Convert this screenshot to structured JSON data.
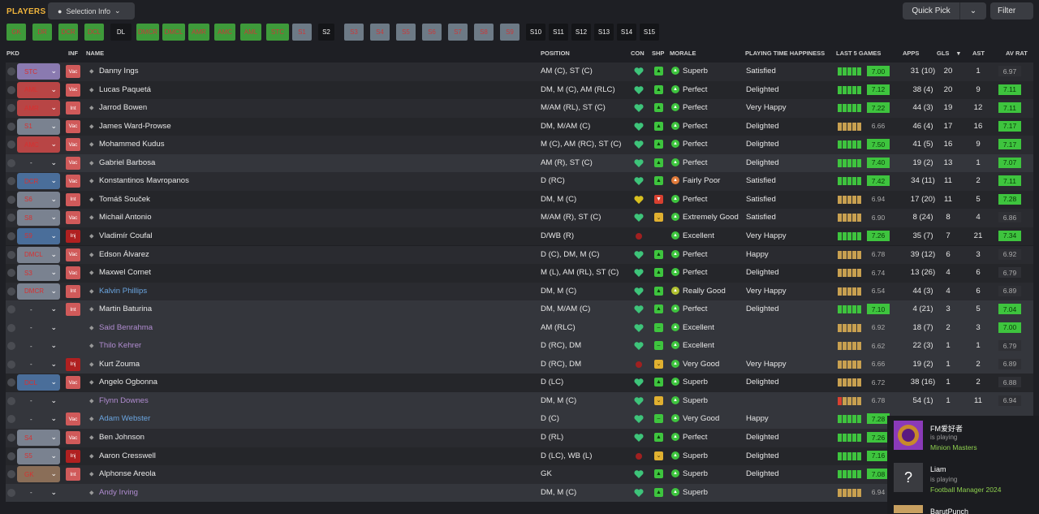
{
  "header": {
    "title": "PLAYERS",
    "selection_label": "Selection Info",
    "quick_pick_label": "Quick Pick",
    "filter_label": "Filter"
  },
  "position_tabs": [
    "GK",
    "DR",
    "DCR",
    "DCL",
    "DL",
    "DMCR",
    "DMCL",
    "AMR",
    "AMC",
    "AML",
    "STC",
    "S1",
    "S2",
    "S3",
    "S4",
    "S5",
    "S6",
    "S7",
    "S8",
    "S9",
    "S10",
    "S11",
    "S12",
    "S13",
    "S14",
    "S15"
  ],
  "columns": {
    "pkd": "PKD",
    "inf": "INF",
    "name": "NAME",
    "position": "POSITION",
    "con": "CON",
    "shp": "SHP",
    "morale": "MORALE",
    "pth": "PLAYING TIME HAPPINESS",
    "last5": "LAST 5 GAMES",
    "apps": "APPS",
    "gls": "GLS",
    "ast": "AST",
    "avrat": "AV RAT"
  },
  "players": [
    {
      "pkd": "STC",
      "pkdc": "purple",
      "inf": "Vac",
      "name": "Danny Ings",
      "nc": "white",
      "pos": "AM (C), ST (C)",
      "con": "green",
      "shp": "up",
      "mor": "Superb",
      "mc": "g",
      "pth": "Satisfied",
      "form": [
        "g",
        "g",
        "g",
        "g",
        "g"
      ],
      "rat": "7.00",
      "rh": true,
      "apps": "31 (10)",
      "gls": "20",
      "ast": "1",
      "av": "6.97",
      "ah": false
    },
    {
      "pkd": "AML",
      "pkdc": "red",
      "inf": "Vac",
      "name": "Lucas Paquetá",
      "nc": "white",
      "pos": "DM, M (C), AM (RLC)",
      "con": "green",
      "shp": "up",
      "mor": "Perfect",
      "mc": "g",
      "pth": "Delighted",
      "form": [
        "g",
        "g",
        "g",
        "g",
        "g"
      ],
      "rat": "7.12",
      "rh": true,
      "apps": "38 (4)",
      "gls": "20",
      "ast": "9",
      "av": "7.11",
      "ah": true
    },
    {
      "pkd": "AMR",
      "pkdc": "red",
      "inf": "Int",
      "name": "Jarrod Bowen",
      "nc": "white",
      "pos": "M/AM (RL), ST (C)",
      "con": "green",
      "shp": "up",
      "mor": "Perfect",
      "mc": "g",
      "pth": "Very Happy",
      "form": [
        "g",
        "g",
        "g",
        "g",
        "g"
      ],
      "rat": "7.22",
      "rh": true,
      "apps": "44 (3)",
      "gls": "19",
      "ast": "12",
      "av": "7.11",
      "ah": true
    },
    {
      "pkd": "S1",
      "pkdc": "slate",
      "inf": "Vac",
      "name": "James Ward-Prowse",
      "nc": "white",
      "pos": "DM, M/AM (C)",
      "con": "green",
      "shp": "up",
      "mor": "Perfect",
      "mc": "g",
      "pth": "Delighted",
      "form": [
        "y",
        "y",
        "y",
        "y",
        "y"
      ],
      "rat": "6.66",
      "rh": false,
      "apps": "46 (4)",
      "gls": "17",
      "ast": "16",
      "av": "7.17",
      "ah": true
    },
    {
      "pkd": "AMC",
      "pkdc": "red",
      "inf": "Vac",
      "name": "Mohammed Kudus",
      "nc": "white",
      "pos": "M (C), AM (RC), ST (C)",
      "con": "green",
      "shp": "up",
      "mor": "Perfect",
      "mc": "g",
      "pth": "Delighted",
      "form": [
        "g",
        "g",
        "g",
        "g",
        "g"
      ],
      "rat": "7.50",
      "rh": true,
      "apps": "41 (5)",
      "gls": "16",
      "ast": "9",
      "av": "7.17",
      "ah": true
    },
    {
      "pkd": "-",
      "pkdc": "none",
      "inf": "Vac",
      "name": "Gabriel Barbosa",
      "nc": "white",
      "pos": "AM (R), ST (C)",
      "con": "green",
      "shp": "up",
      "mor": "Perfect",
      "mc": "g",
      "pth": "Delighted",
      "form": [
        "g",
        "g",
        "g",
        "g",
        "g"
      ],
      "rat": "7.40",
      "rh": true,
      "apps": "19 (2)",
      "gls": "13",
      "ast": "1",
      "av": "7.07",
      "ah": true
    },
    {
      "pkd": "DCR",
      "pkdc": "blue",
      "inf": "Vac",
      "name": "Konstantinos Mavropanos",
      "nc": "white",
      "pos": "D (RC)",
      "con": "green",
      "shp": "up",
      "mor": "Fairly Poor",
      "mc": "o",
      "pth": "Satisfied",
      "form": [
        "g",
        "g",
        "g",
        "g",
        "g"
      ],
      "rat": "7.42",
      "rh": true,
      "apps": "34 (11)",
      "gls": "11",
      "ast": "2",
      "av": "7.11",
      "ah": true
    },
    {
      "pkd": "S6",
      "pkdc": "slate",
      "inf": "Int",
      "name": "Tomáš Souček",
      "nc": "white",
      "pos": "DM, M (C)",
      "con": "yellow",
      "shp": "down",
      "mor": "Perfect",
      "mc": "g",
      "pth": "Satisfied",
      "form": [
        "y",
        "y",
        "y",
        "y",
        "y"
      ],
      "rat": "6.94",
      "rh": false,
      "apps": "17 (20)",
      "gls": "11",
      "ast": "5",
      "av": "7.28",
      "ah": true
    },
    {
      "pkd": "S8",
      "pkdc": "slate",
      "inf": "Vac",
      "name": "Michail Antonio",
      "nc": "white",
      "pos": "M/AM (R), ST (C)",
      "con": "green",
      "shp": "down2",
      "mor": "Extremely Good",
      "mc": "g",
      "pth": "Satisfied",
      "form": [
        "y",
        "y",
        "y",
        "y",
        "y"
      ],
      "rat": "6.90",
      "rh": false,
      "apps": "8 (24)",
      "gls": "8",
      "ast": "4",
      "av": "6.86",
      "ah": false
    },
    {
      "pkd": "S9",
      "pkdc": "blue",
      "inf": "Inj",
      "name": "Vladimír Coufal",
      "nc": "white",
      "pos": "D/WB (R)",
      "con": "injured",
      "shp": "none",
      "mor": "Excellent",
      "mc": "g",
      "pth": "Very Happy",
      "form": [
        "g",
        "g",
        "g",
        "g",
        "g"
      ],
      "rat": "7.26",
      "rh": true,
      "apps": "35 (7)",
      "gls": "7",
      "ast": "21",
      "av": "7.34",
      "ah": true
    },
    {
      "pkd": "DMCL",
      "pkdc": "slate",
      "inf": "Vac",
      "name": "Edson Álvarez",
      "nc": "white",
      "pos": "D (C), DM, M (C)",
      "con": "green",
      "shp": "up",
      "mor": "Perfect",
      "mc": "g",
      "pth": "Happy",
      "form": [
        "y",
        "y",
        "y",
        "y",
        "y"
      ],
      "rat": "6.78",
      "rh": false,
      "apps": "39 (12)",
      "gls": "6",
      "ast": "3",
      "av": "6.92",
      "ah": false
    },
    {
      "pkd": "S3",
      "pkdc": "slate",
      "inf": "Vac",
      "name": "Maxwel Cornet",
      "nc": "white",
      "pos": "M (L), AM (RL), ST (C)",
      "con": "green",
      "shp": "up",
      "mor": "Perfect",
      "mc": "g",
      "pth": "Delighted",
      "form": [
        "y",
        "y",
        "y",
        "y",
        "y"
      ],
      "rat": "6.74",
      "rh": false,
      "apps": "13 (26)",
      "gls": "4",
      "ast": "6",
      "av": "6.79",
      "ah": false
    },
    {
      "pkd": "DMCR",
      "pkdc": "slate",
      "inf": "Int",
      "name": "Kalvin Phillips",
      "nc": "blue",
      "pos": "DM, M (C)",
      "con": "green",
      "shp": "up",
      "mor": "Really Good",
      "mc": "y",
      "pth": "Very Happy",
      "form": [
        "y",
        "y",
        "y",
        "y",
        "y"
      ],
      "rat": "6.54",
      "rh": false,
      "apps": "44 (3)",
      "gls": "4",
      "ast": "6",
      "av": "6.89",
      "ah": false
    },
    {
      "pkd": "-",
      "pkdc": "none",
      "inf": "Int",
      "name": "Martin Baturina",
      "nc": "white",
      "pos": "DM, M/AM (C)",
      "con": "green",
      "shp": "up",
      "mor": "Perfect",
      "mc": "g",
      "pth": "Delighted",
      "form": [
        "g",
        "g",
        "g",
        "g",
        "g"
      ],
      "rat": "7.10",
      "rh": true,
      "apps": "4 (21)",
      "gls": "3",
      "ast": "5",
      "av": "7.04",
      "ah": true
    },
    {
      "pkd": "-",
      "pkdc": "none",
      "inf": "",
      "name": "Said Benrahma",
      "nc": "purple",
      "pos": "AM (RLC)",
      "con": "green",
      "shp": "flat",
      "mor": "Excellent",
      "mc": "g",
      "pth": "",
      "form": [
        "y",
        "y",
        "y",
        "y",
        "y"
      ],
      "rat": "6.92",
      "rh": false,
      "apps": "18 (7)",
      "gls": "2",
      "ast": "3",
      "av": "7.00",
      "ah": true
    },
    {
      "pkd": "-",
      "pkdc": "none",
      "inf": "",
      "name": "Thilo Kehrer",
      "nc": "purple",
      "pos": "D (RC), DM",
      "con": "green",
      "shp": "flat",
      "mor": "Excellent",
      "mc": "g",
      "pth": "",
      "form": [
        "y",
        "y",
        "y",
        "y",
        "y"
      ],
      "rat": "6.62",
      "rh": false,
      "apps": "22 (3)",
      "gls": "1",
      "ast": "1",
      "av": "6.79",
      "ah": false
    },
    {
      "pkd": "-",
      "pkdc": "none",
      "inf": "Inj",
      "name": "Kurt Zouma",
      "nc": "white",
      "pos": "D (RC), DM",
      "con": "injured",
      "shp": "down2",
      "mor": "Very Good",
      "mc": "g",
      "pth": "Very Happy",
      "form": [
        "y",
        "y",
        "y",
        "y",
        "y"
      ],
      "rat": "6.66",
      "rh": false,
      "apps": "19 (2)",
      "gls": "1",
      "ast": "2",
      "av": "6.89",
      "ah": false
    },
    {
      "pkd": "DCL",
      "pkdc": "blue",
      "inf": "Vac",
      "name": "Angelo Ogbonna",
      "nc": "white",
      "pos": "D (LC)",
      "con": "green",
      "shp": "up",
      "mor": "Superb",
      "mc": "g",
      "pth": "Delighted",
      "form": [
        "y",
        "y",
        "y",
        "y",
        "y"
      ],
      "rat": "6.72",
      "rh": false,
      "apps": "38 (16)",
      "gls": "1",
      "ast": "2",
      "av": "6.88",
      "ah": false
    },
    {
      "pkd": "-",
      "pkdc": "none",
      "inf": "",
      "name": "Flynn Downes",
      "nc": "purple",
      "pos": "DM, M (C)",
      "con": "green",
      "shp": "down2",
      "mor": "Superb",
      "mc": "g",
      "pth": "",
      "form": [
        "r",
        "y",
        "y",
        "y",
        "y"
      ],
      "rat": "6.78",
      "rh": false,
      "apps": "54 (1)",
      "gls": "1",
      "ast": "11",
      "av": "6.94",
      "ah": false
    },
    {
      "pkd": "-",
      "pkdc": "none",
      "inf": "Vac",
      "name": "Adam Webster",
      "nc": "blue",
      "pos": "D (C)",
      "con": "green",
      "shp": "flat",
      "mor": "Very Good",
      "mc": "g",
      "pth": "Happy",
      "form": [
        "g",
        "g",
        "g",
        "g",
        "g"
      ],
      "rat": "7.28",
      "rh": true,
      "apps": "",
      "gls": "",
      "ast": "",
      "av": "",
      "ah": false
    },
    {
      "pkd": "S4",
      "pkdc": "slate",
      "inf": "Vac",
      "name": "Ben Johnson",
      "nc": "white",
      "pos": "D (RL)",
      "con": "green",
      "shp": "up",
      "mor": "Perfect",
      "mc": "g",
      "pth": "Delighted",
      "form": [
        "g",
        "g",
        "g",
        "g",
        "g"
      ],
      "rat": "7.26",
      "rh": true,
      "apps": "",
      "gls": "",
      "ast": "",
      "av": "",
      "ah": false
    },
    {
      "pkd": "S5",
      "pkdc": "slate",
      "inf": "Inj",
      "name": "Aaron Cresswell",
      "nc": "white",
      "pos": "D (LC), WB (L)",
      "con": "injured",
      "shp": "down2",
      "mor": "Superb",
      "mc": "g",
      "pth": "Delighted",
      "form": [
        "g",
        "g",
        "g",
        "g",
        "g"
      ],
      "rat": "7.16",
      "rh": true,
      "apps": "",
      "gls": "",
      "ast": "",
      "av": "",
      "ah": false
    },
    {
      "pkd": "GK",
      "pkdc": "brown",
      "inf": "Int",
      "name": "Alphonse Areola",
      "nc": "white",
      "pos": "GK",
      "con": "green",
      "shp": "up",
      "mor": "Superb",
      "mc": "g",
      "pth": "Delighted",
      "form": [
        "g",
        "g",
        "g",
        "g",
        "g"
      ],
      "rat": "7.08",
      "rh": true,
      "apps": "",
      "gls": "",
      "ast": "",
      "av": "",
      "ah": false
    },
    {
      "pkd": "-",
      "pkdc": "none",
      "inf": "",
      "name": "Andy Irving",
      "nc": "purple",
      "pos": "DM, M (C)",
      "con": "green",
      "shp": "up",
      "mor": "Superb",
      "mc": "g",
      "pth": "",
      "form": [
        "y",
        "y",
        "y",
        "y",
        "y"
      ],
      "rat": "6.94",
      "rh": false,
      "apps": "",
      "gls": "",
      "ast": "",
      "av": "",
      "ah": false
    }
  ],
  "friends": [
    {
      "name": "FM爱好者",
      "status": "is playing",
      "game": "Minion Masters"
    },
    {
      "name": "Liam",
      "status": "is playing",
      "game": "Football Manager 2024"
    },
    {
      "name": "BarutPunch",
      "status": "",
      "game": ""
    }
  ]
}
